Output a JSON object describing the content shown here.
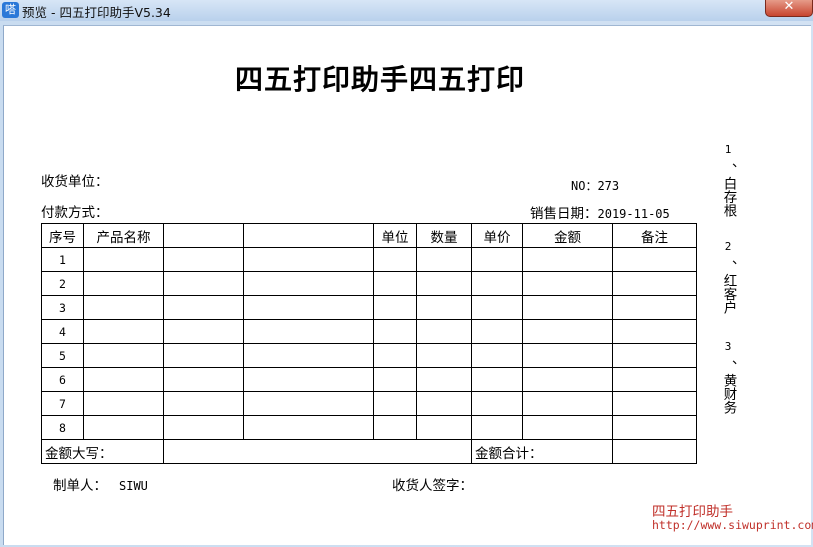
{
  "window": {
    "title": "预览 - 四五打印助手V5.34",
    "icon": "app-logo-icon",
    "icon_glyph": "嗒",
    "close_glyph": "✕"
  },
  "document": {
    "title": "四五打印助手四五打印",
    "receiver_label": "收货单位：",
    "payment_label": "付款方式：",
    "no_label": "NO：",
    "no_value": "273",
    "sale_date_label": "销售日期：",
    "sale_date_value": "2019-11-05",
    "table": {
      "headers": [
        "序号",
        "产品名称",
        "",
        "",
        "单位",
        "数量",
        "单价",
        "金额",
        "备注"
      ],
      "row_numbers": [
        "1",
        "2",
        "3",
        "4",
        "5",
        "6",
        "7",
        "8"
      ],
      "amount_words_label": "金额大写：",
      "amount_total_label": "金额合计："
    },
    "maker_label": "制单人：",
    "maker_value": "SIWU",
    "receiver_sign_label": "收货人签字：",
    "copies": [
      {
        "num": "1",
        "name": "、白存根"
      },
      {
        "num": "2",
        "name": "、红客户"
      },
      {
        "num": "3",
        "name": "、黄财务"
      }
    ]
  },
  "watermark": {
    "name": "四五打印助手",
    "url": "http://www.siwuprint.com"
  },
  "colors": {
    "titlebar": "#c9dcf0",
    "close_button": "#c7452f",
    "watermark": "#c0302a"
  }
}
